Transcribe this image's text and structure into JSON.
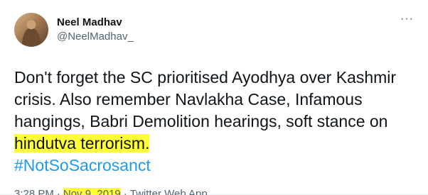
{
  "tweet": {
    "author": {
      "display_name": "Neel Madhav",
      "handle": "@NeelMadhav_"
    },
    "more_label": "···",
    "text_before_highlight": "Don't forget the SC prioritised Ayodhya over Kashmir crisis. Also remember Navlakha Case, Infamous hangings, Babri Demolition hearings, soft stance on ",
    "text_highlighted": "hindutva terrorism.",
    "hashtag": "#NotSoSacrosanct",
    "time": "3:28 PM",
    "separator": "·",
    "date": "Nov 9, 2019",
    "source": "Twitter Web App"
  },
  "colors": {
    "highlight": "#ffff3a",
    "link": "#1d9bf0",
    "secondary_text": "#536471",
    "primary_text": "#0f1419"
  }
}
